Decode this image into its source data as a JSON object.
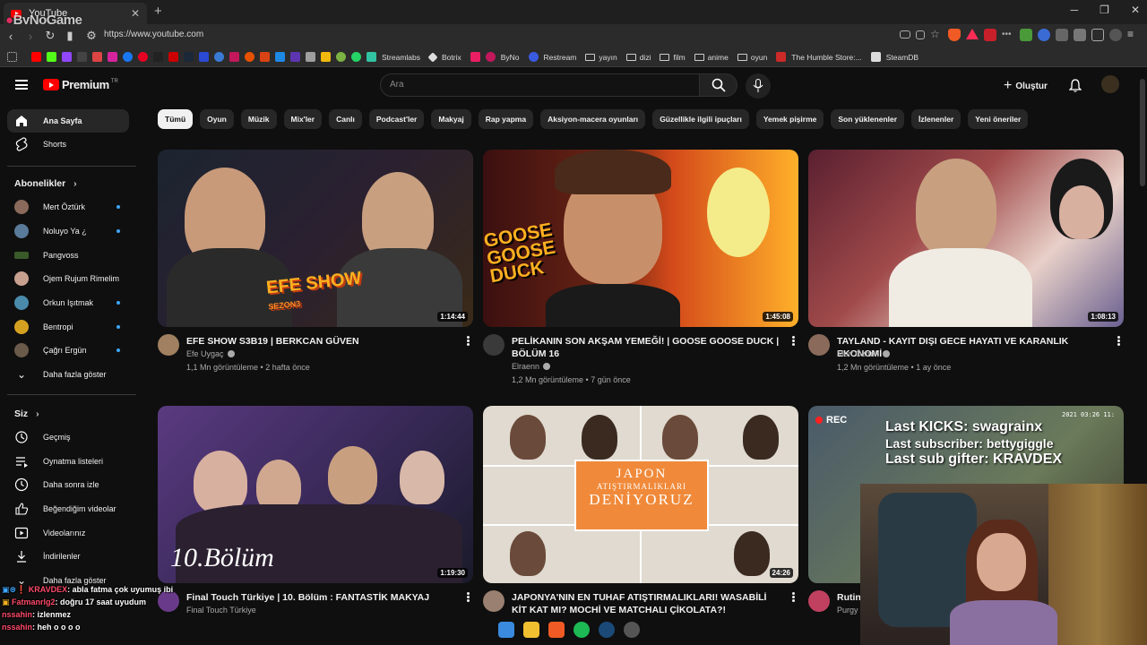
{
  "browser": {
    "tab_title": "YouTube",
    "url": "https://www.youtube.com",
    "watermark": "ByNoGame",
    "bookmarks": [
      "Streamlabs",
      "Botrix",
      "ByNo",
      "Restream",
      "yayın",
      "dizi",
      "film",
      "anime",
      "oyun",
      "The Humble Store:...",
      "SteamDB"
    ]
  },
  "header": {
    "logo_text": "Premium",
    "logo_sup": "TR",
    "search_placeholder": "Ara",
    "create_label": "Oluştur"
  },
  "sidebar": {
    "main": [
      {
        "label": "Ana Sayfa",
        "icon": "home-icon",
        "active": true
      },
      {
        "label": "Shorts",
        "icon": "shorts-icon"
      }
    ],
    "subscriptions_heading": "Abonelikler",
    "subscriptions": [
      {
        "label": "Mert Öztürk"
      },
      {
        "label": "Noluyo Ya ¿"
      },
      {
        "label": "Pangvoss"
      },
      {
        "label": "Ojem Rujum Rimelim"
      },
      {
        "label": "Orkun Işıtmak"
      },
      {
        "label": "Bentropi"
      },
      {
        "label": "Çağrı Ergün"
      }
    ],
    "show_more": "Daha fazla göster",
    "you_heading": "Siz",
    "you_items": [
      {
        "label": "Geçmiş",
        "icon": "history-icon"
      },
      {
        "label": "Oynatma listeleri",
        "icon": "playlists-icon"
      },
      {
        "label": "Daha sonra izle",
        "icon": "watch-later-icon"
      },
      {
        "label": "Beğendiğim videolar",
        "icon": "liked-icon"
      },
      {
        "label": "Videolarınız",
        "icon": "your-videos-icon"
      },
      {
        "label": "İndirilenler",
        "icon": "downloads-icon"
      },
      {
        "label": "Daha fazla göster",
        "icon": "chevron-down-icon"
      }
    ]
  },
  "chips": [
    "Tümü",
    "Oyun",
    "Müzik",
    "Mix'ler",
    "Canlı",
    "Podcast'ler",
    "Makyaj",
    "Rap yapma",
    "Aksiyon-macera oyunları",
    "Güzellikle ilgili ipuçları",
    "Yemek pişirme",
    "Son yüklenenler",
    "İzlenenler",
    "Yeni öneriler"
  ],
  "videos": [
    {
      "title": "EFE SHOW S3B19 | BERKCAN GÜVEN",
      "channel": "Efe Uygaç",
      "meta": "1,1 Mn görüntüleme • 2 hafta önce",
      "duration": "1:14:44",
      "thumb_text": "EFE SHOW",
      "thumb_sub": "SEZON3"
    },
    {
      "title": "PELİKANIN SON AKŞAM YEMEĞİ! | GOOSE GOOSE DUCK | BÖLÜM 16",
      "channel": "Elraenn",
      "meta": "1,2 Mn görüntüleme • 7 gün önce",
      "duration": "1:45:08",
      "thumb_text": "GOOSE GOOSE DUCK"
    },
    {
      "title": "TAYLAND - KAYIT DIŞI GECE HAYATI VE KARANLIK EKONOMİ",
      "channel": "Mert Öztürk",
      "meta": "1,2 Mn görüntüleme • 1 ay önce",
      "duration": "1:08:13"
    },
    {
      "title": "Final Touch Türkiye | 10. Bölüm : FANTASTİK MAKYAJ",
      "channel": "Final Touch Türkiye",
      "meta": "",
      "duration": "1:19:30",
      "thumb_text": "10.Bölüm"
    },
    {
      "title": "JAPONYA'NIN EN TUHAF ATIŞTIRMALIKLARI! WASABİLİ KİT KAT MI? MOCHİ VE MATCHALI ÇİKOLATA?!",
      "channel": "",
      "meta": "",
      "duration": "24:26",
      "thumb_l1": "JAPON",
      "thumb_l2": "ATIŞTIRMALIKLARI",
      "thumb_l3": "DENİYORUZ"
    },
    {
      "title": "Rutin",
      "channel": "Purgy",
      "meta": "",
      "duration": "",
      "thumb_text": "REC"
    }
  ],
  "stream_overlay": {
    "last_kicks": "Last KICKS: swagrainx",
    "last_sub": "Last subscriber: bettygiggle",
    "last_gifter": "Last sub gifter: KRAVDEX",
    "timestamp": "2021 03:26 11:"
  },
  "chat": [
    {
      "name": "KRAVDEX",
      "msg": ": abla fatma çok uyumuş ibi"
    },
    {
      "name": "Fatmanrlg2",
      "msg": ": doğru 17 saat uyudum"
    },
    {
      "name": "nssahin",
      "msg": ": izlenmez"
    },
    {
      "name": "nssahin",
      "msg": ": heh o o o o"
    }
  ],
  "colors": {
    "background": "#0f0f0f",
    "accent": "#ff0000",
    "chip_active": "#f1f1f1",
    "link": "#3ea6ff"
  }
}
